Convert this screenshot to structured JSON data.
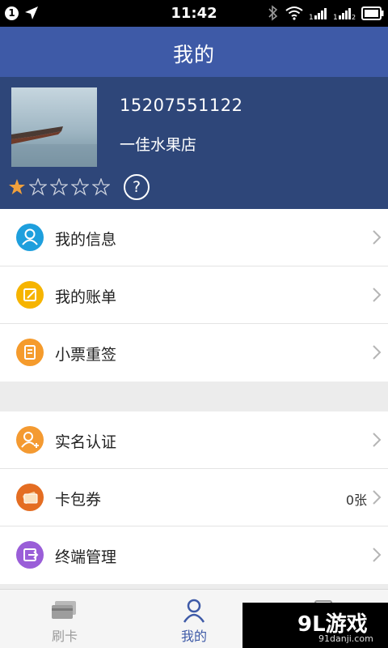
{
  "status_bar": {
    "time": "11:42",
    "notification_count": "1",
    "battery_icon": "battery-icon",
    "wifi_icon": "wifi-icon",
    "bluetooth_icon": "bluetooth-icon"
  },
  "header": {
    "title": "我的"
  },
  "profile": {
    "phone": "15207551122",
    "shop_name": "一佳水果店",
    "rating": 1,
    "rating_max": 5,
    "help_label": "?"
  },
  "menu_group_1": [
    {
      "label": "我的信息",
      "icon": "user-info-icon",
      "color": "#1e9fdd"
    },
    {
      "label": "我的账单",
      "icon": "bill-icon",
      "color": "#f6b400"
    },
    {
      "label": "小票重签",
      "icon": "receipt-resign-icon",
      "color": "#f59b2c"
    }
  ],
  "menu_group_2": [
    {
      "label": "实名认证",
      "icon": "real-name-auth-icon",
      "color": "#f49a31",
      "value": ""
    },
    {
      "label": "卡包券",
      "icon": "card-coupon-icon",
      "color": "#e46d22",
      "value": "0张"
    },
    {
      "label": "终端管理",
      "icon": "terminal-manage-icon",
      "color": "#9a5ed8",
      "value": ""
    }
  ],
  "bottom_nav": [
    {
      "label": "刷卡",
      "active": false
    },
    {
      "label": "我的",
      "active": true
    },
    {
      "label": "",
      "active": false
    }
  ],
  "watermark": {
    "logo": "9L游戏",
    "site": "91danji.com"
  },
  "colors": {
    "header": "#3e5aa7",
    "profile": "#2e4679",
    "active_tab": "#3e5aa7",
    "inactive_tab": "#9a9a9a",
    "star": "#f0a03c"
  }
}
